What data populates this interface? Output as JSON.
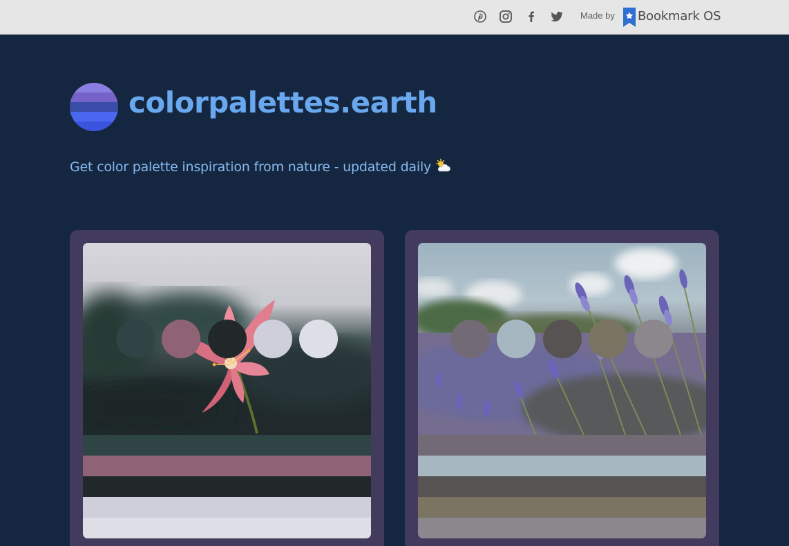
{
  "header": {
    "social_icons": [
      "pinterest-icon",
      "instagram-icon",
      "facebook-icon",
      "twitter-icon"
    ],
    "made_by_label": "Made by",
    "brand_name": "Bookmark OS",
    "brand_color": "#2f6fd1"
  },
  "site": {
    "title": "colorpalettes.earth",
    "tagline": "Get color palette inspiration from nature - updated daily",
    "tagline_emoji": "sun-behind-cloud-icon",
    "logo_colors": [
      "#8a7fe0",
      "#7563c9",
      "#3a4da8",
      "#4a67f0",
      "#3a54dd"
    ]
  },
  "palettes": [
    {
      "image": "pink-lily-flower-photo",
      "colors": [
        "#2f4444",
        "#8f6373",
        "#222829",
        "#cfcfdb",
        "#dedfe6"
      ]
    },
    {
      "image": "lavender-field-photo",
      "colors": [
        "#726a75",
        "#a6b7c1",
        "#575352",
        "#7b7463",
        "#8c878d"
      ]
    }
  ]
}
